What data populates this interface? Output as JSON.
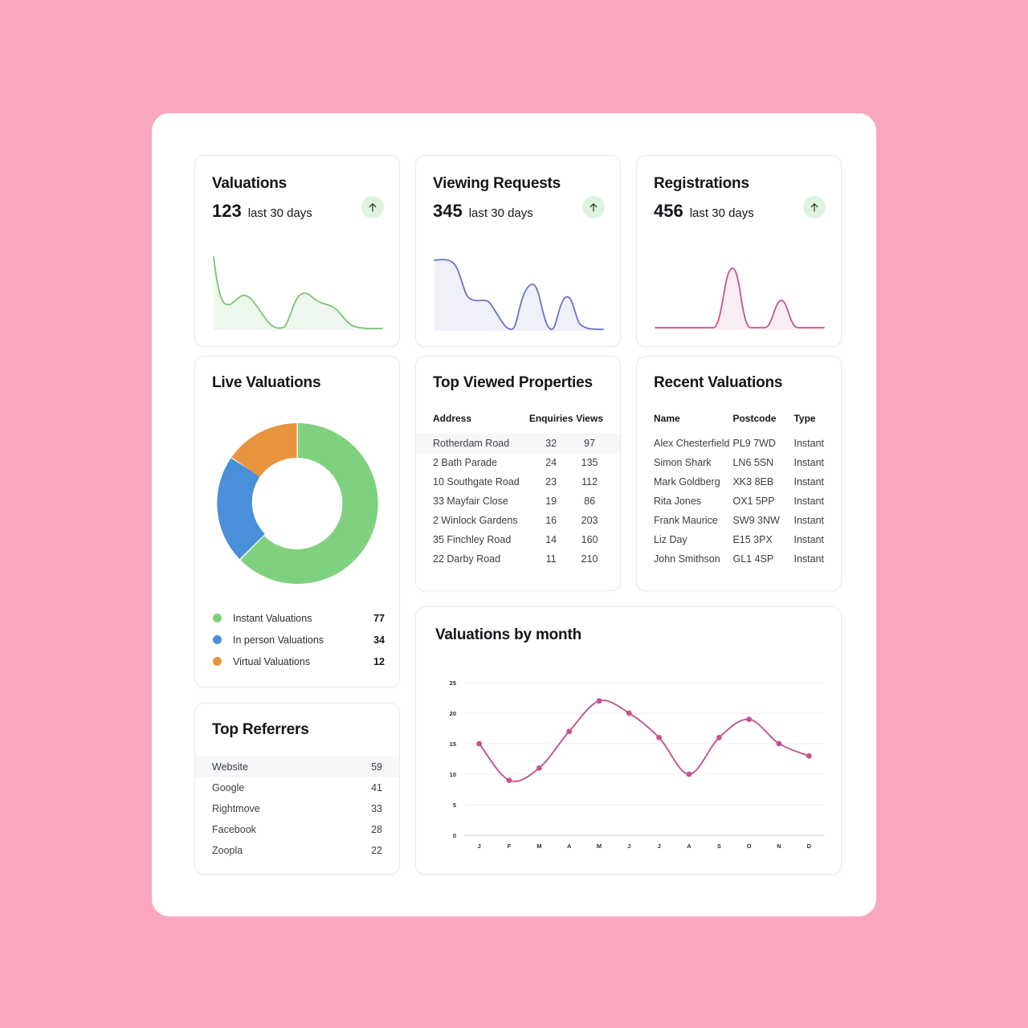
{
  "theme": {
    "background": "#fca7c0",
    "panel": "#ffffff",
    "green": "#7fd17f",
    "blue": "#4a90d9",
    "orange": "#e8943f",
    "pink": "#c4548f",
    "spark_green": "#7ac47a",
    "spark_blue": "#6b72c4",
    "spark_pink": "#c4548f",
    "badge_bg": "#ddf3e0",
    "row_highlight": "#f6f7f8"
  },
  "kpis": [
    {
      "title": "Valuations",
      "value": "123",
      "subtitle": "last 30 days",
      "trend_icon": "arrow-up-icon"
    },
    {
      "title": "Viewing Requests",
      "value": "345",
      "subtitle": "last 30 days",
      "trend_icon": "arrow-up-icon"
    },
    {
      "title": "Registrations",
      "value": "456",
      "subtitle": "last 30 days",
      "trend_icon": "arrow-up-icon"
    }
  ],
  "live_valuations": {
    "title": "Live Valuations",
    "legend": [
      {
        "label": "Instant Valuations",
        "value": "77",
        "color": "#7fd17f"
      },
      {
        "label": "In person Valuations",
        "value": "34",
        "color": "#4a90d9"
      },
      {
        "label": "Virtual Valuations",
        "value": "12",
        "color": "#e8943f"
      }
    ]
  },
  "top_viewed": {
    "title": "Top Viewed Properties",
    "columns": [
      "Address",
      "Enquiries",
      "Views"
    ],
    "rows": [
      {
        "address": "Rotherdam Road",
        "enquiries": "32",
        "views": "97"
      },
      {
        "address": "2 Bath Parade",
        "enquiries": "24",
        "views": "135"
      },
      {
        "address": "10 Southgate Road",
        "enquiries": "23",
        "views": "112"
      },
      {
        "address": "33 Mayfair Close",
        "enquiries": "19",
        "views": "86"
      },
      {
        "address": "2 Winlock Gardens",
        "enquiries": "16",
        "views": "203"
      },
      {
        "address": "35 Finchley Road",
        "enquiries": "14",
        "views": "160"
      },
      {
        "address": "22 Darby Road",
        "enquiries": "11",
        "views": "210"
      }
    ]
  },
  "recent_valuations": {
    "title": "Recent Valuations",
    "columns": [
      "Name",
      "Postcode",
      "Type"
    ],
    "rows": [
      {
        "name": "Alex Chesterfield",
        "postcode": "PL9 7WD",
        "type": "Instant"
      },
      {
        "name": "Simon Shark",
        "postcode": "LN6 5SN",
        "type": "Instant"
      },
      {
        "name": "Mark Goldberg",
        "postcode": "XK3 8EB",
        "type": "Instant"
      },
      {
        "name": "Rita Jones",
        "postcode": "OX1 5PP",
        "type": "Instant"
      },
      {
        "name": "Frank Maurice",
        "postcode": "SW9 3NW",
        "type": "Instant"
      },
      {
        "name": "Liz Day",
        "postcode": "E15 3PX",
        "type": "Instant"
      },
      {
        "name": "John Smithson",
        "postcode": "GL1 4SP",
        "type": "Instant"
      }
    ]
  },
  "top_referrers": {
    "title": "Top Referrers",
    "rows": [
      {
        "label": "Website",
        "value": "59"
      },
      {
        "label": "Google",
        "value": "41"
      },
      {
        "label": "Rightmove",
        "value": "33"
      },
      {
        "label": "Facebook",
        "value": "28"
      },
      {
        "label": "Zoopla",
        "value": "22"
      }
    ]
  },
  "chart_data": [
    {
      "type": "line",
      "title": "Valuations by month",
      "categories": [
        "J",
        "F",
        "M",
        "A",
        "M",
        "J",
        "J",
        "A",
        "S",
        "O",
        "N",
        "D"
      ],
      "values": [
        15,
        9,
        11,
        17,
        22,
        20,
        16,
        10,
        16,
        19,
        15,
        13
      ],
      "xlabel": "",
      "ylabel": "",
      "ylim": [
        0,
        25
      ],
      "yticks": [
        0,
        5,
        10,
        15,
        20,
        25
      ],
      "grid": true,
      "legend": "none",
      "color": "#c4548f",
      "markers": true
    },
    {
      "type": "pie",
      "title": "Live Valuations",
      "subtype": "donut",
      "labels": [
        "Instant Valuations",
        "In person Valuations",
        "Virtual Valuations"
      ],
      "values": [
        77,
        34,
        12
      ],
      "colors": [
        "#7fd17f",
        "#4a90d9",
        "#e8943f"
      ],
      "total": 123
    },
    {
      "type": "area",
      "title": "Valuations",
      "values": [
        97,
        34,
        40,
        37,
        30,
        20,
        14,
        10,
        38,
        52,
        48,
        47,
        30,
        14,
        10,
        9
      ],
      "color": "#7ac47a",
      "ylim": [
        0,
        100
      ]
    },
    {
      "type": "area",
      "title": "Viewing Requests",
      "values": [
        90,
        90,
        84,
        45,
        40,
        43,
        30,
        12,
        8,
        6,
        66,
        8,
        4,
        48,
        14,
        8,
        7
      ],
      "color": "#6b72c4",
      "ylim": [
        0,
        100
      ]
    },
    {
      "type": "area",
      "title": "Registrations",
      "values": [
        2,
        2,
        2,
        2,
        2,
        2,
        90,
        4,
        2,
        2,
        36,
        3,
        2,
        2,
        2
      ],
      "color": "#c4548f",
      "ylim": [
        0,
        100
      ]
    }
  ]
}
